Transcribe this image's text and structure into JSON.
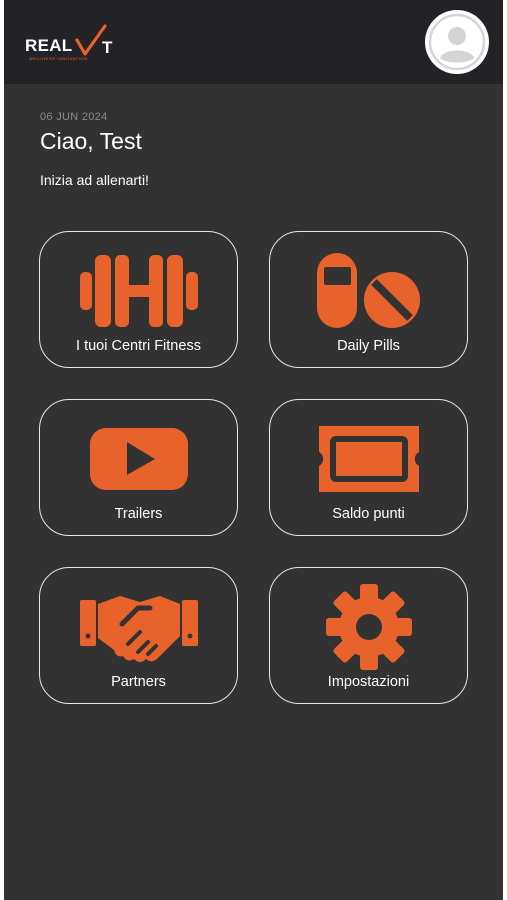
{
  "header": {
    "logo_text": "REAL",
    "logo_tagline": "WELLNESS INNOVATION",
    "accent_color": "#e8622b",
    "avatar_icon": "user-avatar-icon"
  },
  "welcome": {
    "date": "06 JUN 2024",
    "greeting": "Ciao, Test",
    "subtitle": "Inizia ad allenarti!"
  },
  "tiles": [
    {
      "label": "I tuoi Centri Fitness",
      "icon": "dumbbell-icon"
    },
    {
      "label": "Daily Pills",
      "icon": "pills-icon"
    },
    {
      "label": "Trailers",
      "icon": "play-icon"
    },
    {
      "label": "Saldo punti",
      "icon": "ticket-icon"
    },
    {
      "label": "Partners",
      "icon": "handshake-icon"
    },
    {
      "label": "Impostazioni",
      "icon": "gear-icon"
    }
  ]
}
